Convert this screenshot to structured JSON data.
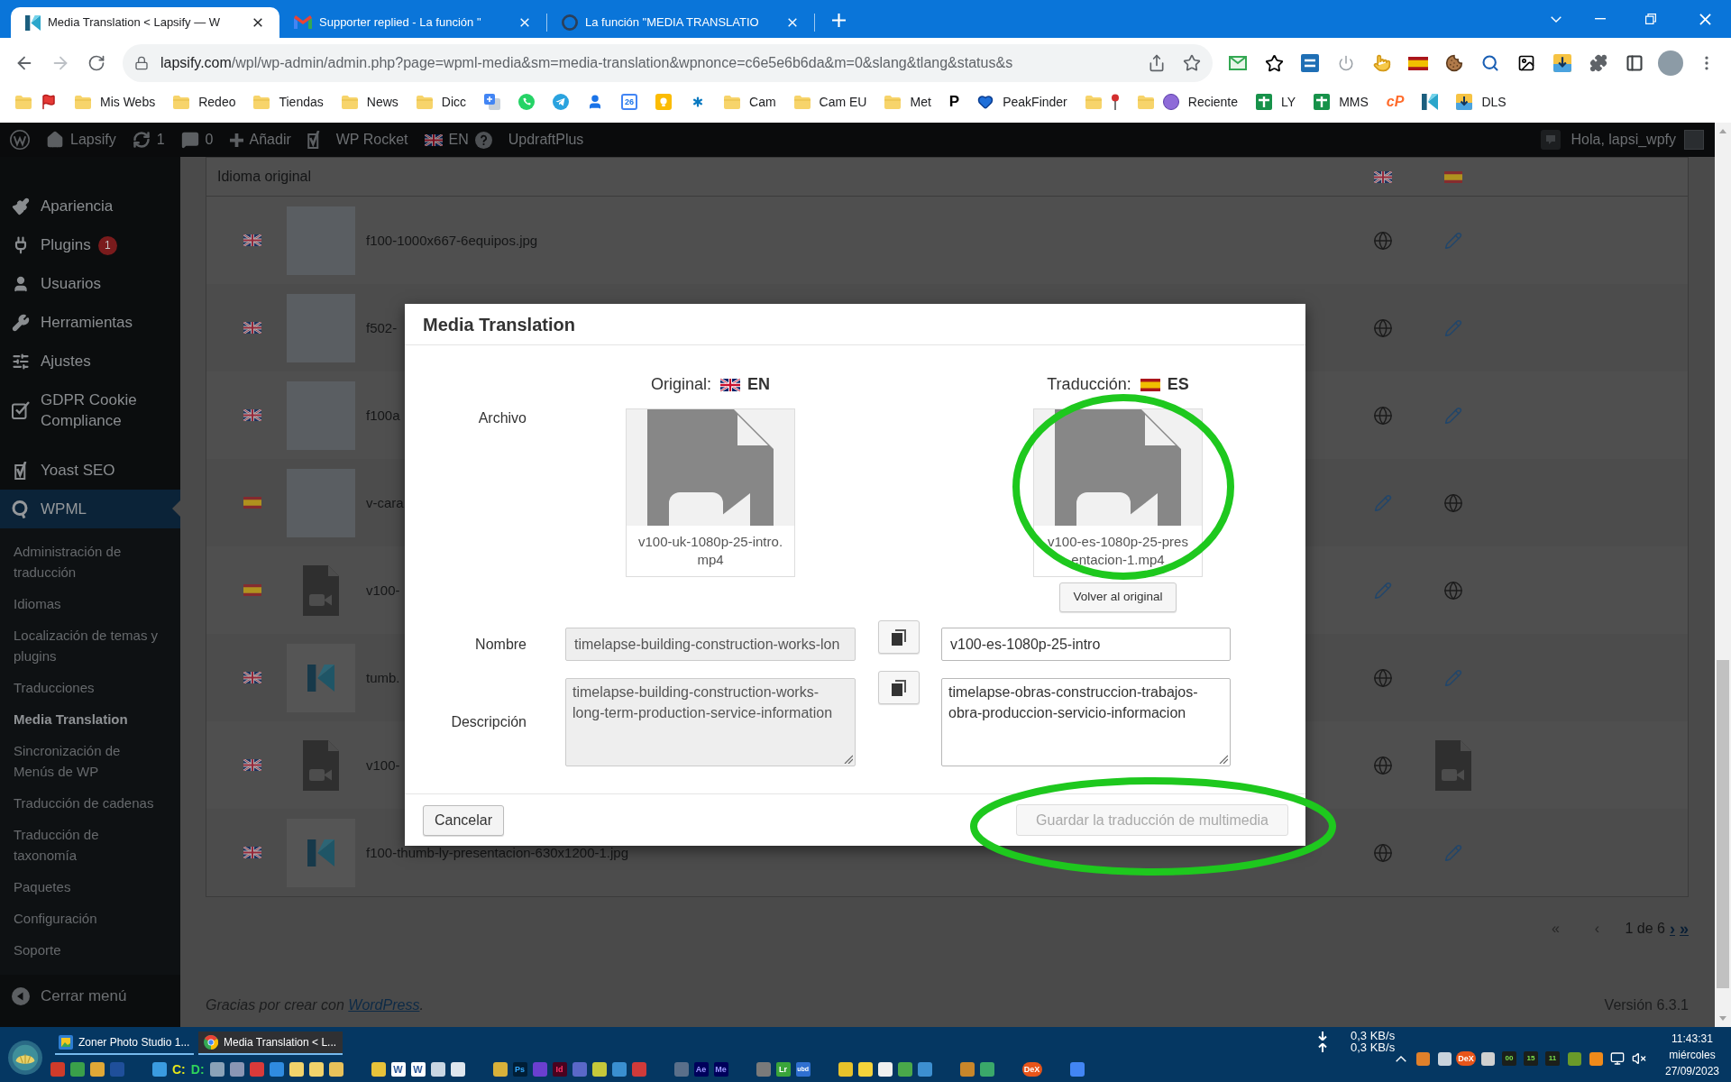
{
  "browser": {
    "tabs": [
      {
        "kind": "lapsify",
        "title": "Media Translation < Lapsify — W",
        "selected": true
      },
      {
        "kind": "gmail",
        "title": "Supporter replied - La función \"",
        "selected": false
      },
      {
        "kind": "wpml",
        "title": "La función \"MEDIA TRANSLATIO",
        "selected": false
      }
    ],
    "url": {
      "host": "lapsify.com",
      "path": "/wpl/wp-admin/admin.php?page=wpml-media&sm=media-translation&wpnonce=c6e5e6b6da&m=0&slang&tlang&status&s"
    },
    "bookmarks": [
      {
        "kind": "folder",
        "extra": {
          "kind": "flag"
        }
      },
      {
        "kind": "folder",
        "label": "Mis Webs"
      },
      {
        "kind": "folder",
        "label": "Redeo"
      },
      {
        "kind": "folder",
        "label": "Tiendas"
      },
      {
        "kind": "folder",
        "label": "News"
      },
      {
        "kind": "folder",
        "label": "Dicc"
      },
      {
        "kind": "translate"
      },
      {
        "kind": "whatsapp"
      },
      {
        "kind": "telegram"
      },
      {
        "kind": "person"
      },
      {
        "kind": "calendar",
        "icon_text": "26"
      },
      {
        "kind": "keep"
      },
      {
        "kind": "star"
      },
      {
        "kind": "folder",
        "label": "Cam"
      },
      {
        "kind": "folder",
        "label": "Cam EU"
      },
      {
        "kind": "folder",
        "label": "Met"
      },
      {
        "kind": "letter",
        "icon_text": "P"
      },
      {
        "kind": "heart",
        "label": "PeakFinder"
      },
      {
        "kind": "folder",
        "extra": {
          "kind": "pin"
        }
      },
      {
        "kind": "folder",
        "extra": {
          "kind": "circle"
        },
        "label": "Reciente"
      },
      {
        "kind": "cross",
        "label": "LY"
      },
      {
        "kind": "cross",
        "label": "MMS"
      },
      {
        "kind": "cpanel",
        "icon_text": "cP"
      },
      {
        "kind": "lapsify"
      },
      {
        "kind": "download",
        "label": "DLS"
      }
    ]
  },
  "admin_bar": {
    "items": [
      {
        "kind": "wordpress"
      },
      {
        "kind": "site",
        "label": "Lapsify"
      },
      {
        "kind": "updates",
        "label": "1"
      },
      {
        "kind": "comments",
        "label": "0"
      },
      {
        "kind": "new",
        "label": "Añadir"
      },
      {
        "kind": "yoast"
      },
      {
        "kind": "menu",
        "label": "WP Rocket"
      },
      {
        "kind": "language",
        "label": "EN"
      },
      {
        "kind": "menu",
        "label": "UpdraftPlus"
      }
    ],
    "greeting": "Hola, lapsi_wpfy"
  },
  "sidebar": {
    "items": [
      {
        "kind": "appearance",
        "label": "Apariencia",
        "selected": false
      },
      {
        "kind": "plugins",
        "label": "Plugins",
        "badge": "1",
        "selected": false
      },
      {
        "kind": "users",
        "label": "Usuarios",
        "selected": false
      },
      {
        "kind": "tools",
        "label": "Herramientas",
        "selected": false
      },
      {
        "kind": "settings",
        "label": "Ajustes",
        "selected": false
      },
      {
        "kind": "gdpr",
        "label": "GDPR Cookie Compliance",
        "selected": false
      },
      {
        "kind": "yoast",
        "label": "Yoast SEO",
        "selected": false
      },
      {
        "kind": "wpml",
        "label": "WPML",
        "selected": true,
        "children": [
          {
            "label": "Administración de traducción",
            "selected": false
          },
          {
            "label": "Idiomas",
            "selected": false
          },
          {
            "label": "Localización de temas y plugins",
            "selected": false
          },
          {
            "label": "Traducciones",
            "selected": false
          },
          {
            "label": "Media Translation",
            "selected": true
          },
          {
            "label": "Sincronización de Menús de WP",
            "selected": false
          },
          {
            "label": "Traducción de cadenas",
            "selected": false
          },
          {
            "label": "Traducción de taxonomía",
            "selected": false
          },
          {
            "label": "Paquetes",
            "selected": false
          },
          {
            "label": "Configuración",
            "selected": false
          },
          {
            "label": "Soporte",
            "selected": false
          }
        ]
      }
    ],
    "collapse": "Cerrar menú"
  },
  "table": {
    "header": {
      "label": "Idioma original",
      "flags": [
        {
          "kind": "uk"
        },
        {
          "kind": "es"
        }
      ]
    },
    "rows": [
      {
        "flag": {
          "kind": "uk"
        },
        "thumbnail": {
          "kind": "photo"
        },
        "name": "f100-1000x667-6equipos.jpg",
        "cells": [
          {
            "kind": "globe"
          },
          {
            "kind": "pencil"
          }
        ]
      },
      {
        "flag": {
          "kind": "uk"
        },
        "thumbnail": {
          "kind": "photo"
        },
        "name": "f502-",
        "cells": [
          {
            "kind": "globe"
          },
          {
            "kind": "pencil"
          }
        ]
      },
      {
        "flag": {
          "kind": "uk"
        },
        "thumbnail": {
          "kind": "photo"
        },
        "name": "f100a",
        "cells": [
          {
            "kind": "globe"
          },
          {
            "kind": "pencil"
          }
        ]
      },
      {
        "flag": {
          "kind": "es"
        },
        "thumbnail": {
          "kind": "photo"
        },
        "name": "v-cara",
        "cells": [
          {
            "kind": "pencil"
          },
          {
            "kind": "globe"
          }
        ]
      },
      {
        "flag": {
          "kind": "es"
        },
        "thumbnail": {
          "kind": "video"
        },
        "name": "v100-",
        "cells": [
          {
            "kind": "pencil"
          },
          {
            "kind": "globe"
          }
        ]
      },
      {
        "flag": {
          "kind": "uk"
        },
        "thumbnail": {
          "kind": "logo"
        },
        "name": "tumb.",
        "cells": [
          {
            "kind": "globe"
          },
          {
            "kind": "pencil"
          }
        ]
      },
      {
        "flag": {
          "kind": "uk"
        },
        "thumbnail": {
          "kind": "video"
        },
        "name": "v100-",
        "cells": [
          {
            "kind": "globe"
          },
          {
            "kind": "video"
          }
        ]
      },
      {
        "flag": {
          "kind": "uk"
        },
        "thumbnail": {
          "kind": "logo"
        },
        "name": "f100-thumb-ly-presentacion-630x1200-1.jpg",
        "cells": [
          {
            "kind": "globe"
          },
          {
            "kind": "pencil"
          }
        ]
      }
    ]
  },
  "pagination": {
    "back": [
      {
        "label": "«",
        "disabled": true
      },
      {
        "label": "‹",
        "disabled": true
      }
    ],
    "page": "1 de 6",
    "forward": [
      {
        "label": "›",
        "disabled": false
      },
      {
        "label": "»",
        "disabled": false
      }
    ]
  },
  "footer": {
    "before": "Gracias por crear con ",
    "link": "WordPress",
    "after": ".",
    "version": "Versión 6.3.1"
  },
  "modal": {
    "title": "Media Translation",
    "original": {
      "label": "Original:",
      "flag": {
        "kind": "uk"
      },
      "code": "EN",
      "file": "v100-uk-1080p-25-intro.mp4"
    },
    "translation": {
      "label": "Traducción:",
      "flag": {
        "kind": "es"
      },
      "code": "ES",
      "file": "v100-es-1080p-25-presentacion-1.mp4",
      "revert_button": "Volver al original"
    },
    "file_label": "Archivo",
    "fields": [
      {
        "kind": "input",
        "label": "Nombre",
        "original": {
          "value": "timelapse-building-construction-works-lon",
          "disabled": true
        },
        "translation": {
          "value": "v100-es-1080p-25-intro",
          "disabled": false
        }
      },
      {
        "kind": "textarea",
        "label": "Descripción",
        "original": {
          "value": "timelapse-building-construction-works-long-term-production-service-information",
          "disabled": true
        },
        "translation": {
          "value": "timelapse-obras-construccion-trabajos-obra-produccion-servicio-informacion",
          "disabled": false
        }
      }
    ],
    "buttons": [
      {
        "label": "Cancelar",
        "disabled": false
      },
      {
        "label": "Guardar la traducción de multimedia",
        "disabled": true
      }
    ]
  },
  "taskbar": {
    "windows": [
      {
        "kind": "photo",
        "title": "Zoner Photo Studio 1...",
        "selected": false
      },
      {
        "kind": "browser",
        "title": "Media Translation < L...",
        "selected": true
      }
    ],
    "quick_launch": [
      {
        "kind": "drive",
        "label": "C:",
        "color": "#e6e619"
      },
      {
        "kind": "drive",
        "label": "D:",
        "color": "#2fd35a"
      },
      {
        "kind": "word",
        "label": "W"
      },
      {
        "kind": "word",
        "label": "W"
      },
      {
        "kind": "ps",
        "label": "Ps"
      },
      {
        "kind": "id",
        "label": "Id"
      },
      {
        "kind": "ae",
        "label": "Ae"
      },
      {
        "kind": "me",
        "label": "Me"
      },
      {
        "kind": "lr",
        "label": "Lr"
      },
      {
        "kind": "ubd",
        "label": "ubd"
      },
      {
        "kind": "dex",
        "label": "DeX"
      }
    ],
    "network": [
      "0,3 KB/s",
      "0,3 KB/s"
    ],
    "tray": [
      {
        "kind": "dex",
        "label": "DeX"
      },
      {
        "kind": "digits",
        "label": "00"
      },
      {
        "kind": "digits",
        "label": "15"
      },
      {
        "kind": "digits",
        "label": "11"
      }
    ],
    "clock": {
      "time": "11:43:31",
      "day": "miércoles",
      "date": "27/09/2023"
    }
  }
}
